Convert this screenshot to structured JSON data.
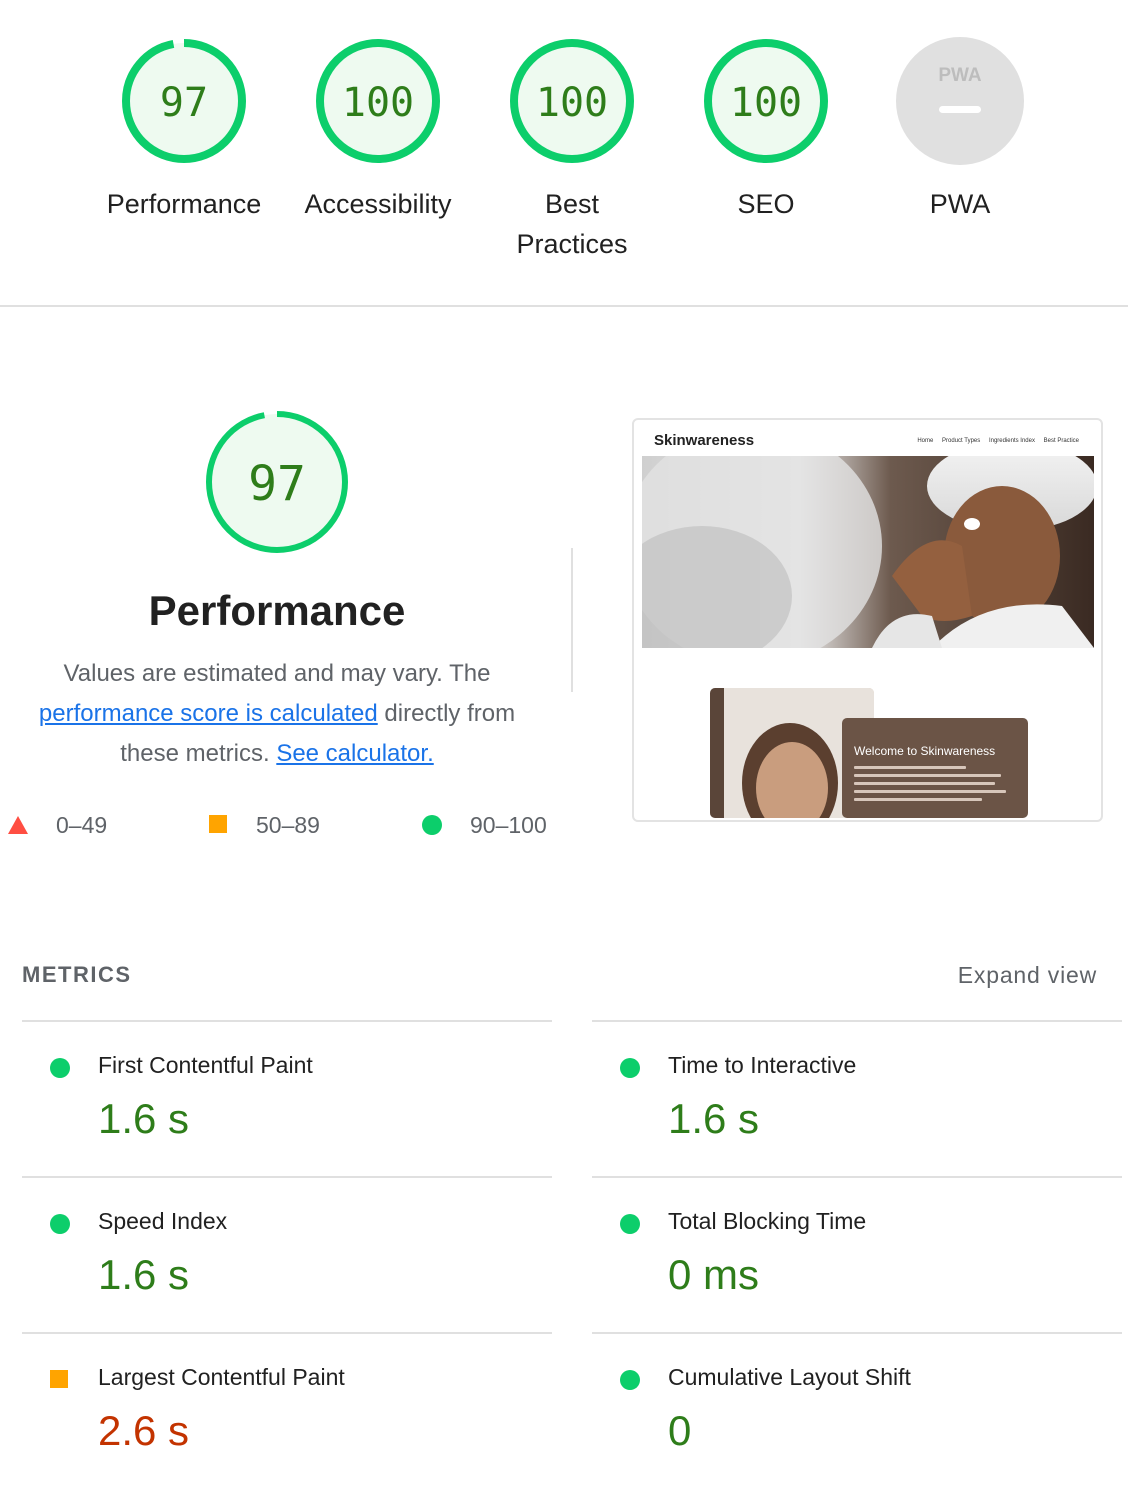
{
  "colors": {
    "pass": "#0cce6b",
    "pass_text": "#2e7d1a",
    "pass_fill": "#eefaf0",
    "average": "#ffa400",
    "fail": "#ff4e42",
    "na": "#e0e0e0",
    "link": "#1a73e8"
  },
  "gauges": [
    {
      "score": "97",
      "label": "Performance"
    },
    {
      "score": "100",
      "label": "Accessibility"
    },
    {
      "score": "100",
      "label": "Best Practices"
    },
    {
      "score": "100",
      "label": "SEO"
    },
    {
      "score": "PWA",
      "label": "PWA",
      "na": true
    }
  ],
  "performance": {
    "score": "97",
    "title": "Performance",
    "desc_pre": "Values are estimated and may vary. The",
    "desc_link": "performance score is calculated",
    "desc_mid": "directly from these metrics.",
    "desc_link2": "See calculator.",
    "legend": [
      {
        "icon": "triangle-icon",
        "range": "0–49"
      },
      {
        "icon": "square-icon",
        "range": "50–89"
      },
      {
        "icon": "circle-icon",
        "range": "90–100"
      }
    ]
  },
  "screenshot": {
    "brand": "Skinwareness",
    "nav": [
      "Home",
      "Product Types",
      "Ingredients Index",
      "Best Practice"
    ],
    "card_title": "Welcome to Skinwareness"
  },
  "metrics": {
    "header": "METRICS",
    "expand": "Expand view",
    "items": [
      {
        "label": "First Contentful Paint",
        "value": "1.6 s",
        "status": "pass"
      },
      {
        "label": "Time to Interactive",
        "value": "1.6 s",
        "status": "pass"
      },
      {
        "label": "Speed Index",
        "value": "1.6 s",
        "status": "pass"
      },
      {
        "label": "Total Blocking Time",
        "value": "0 ms",
        "status": "pass"
      },
      {
        "label": "Largest Contentful Paint",
        "value": "2.6 s",
        "status": "average"
      },
      {
        "label": "Cumulative Layout Shift",
        "value": "0",
        "status": "pass"
      }
    ]
  }
}
